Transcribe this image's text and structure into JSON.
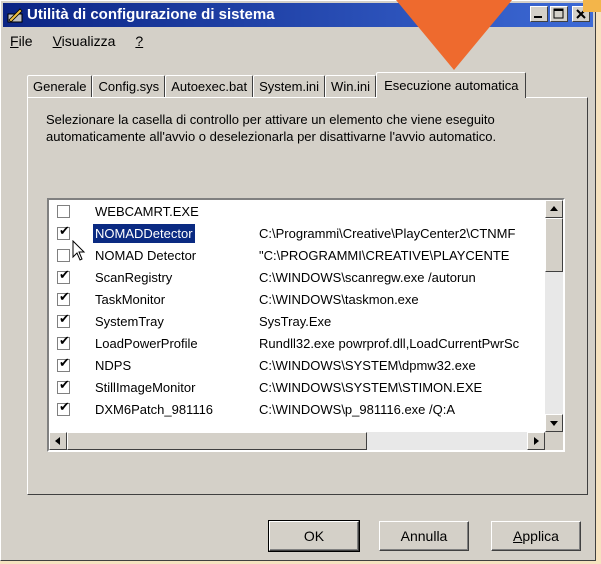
{
  "window": {
    "title": "Utilità di configurazione di sistema"
  },
  "menu": [
    {
      "label": "File",
      "ul": "F",
      "rest": "ile"
    },
    {
      "label": "Visualizza",
      "ul": "V",
      "rest": "isualizza"
    },
    {
      "label": "?",
      "ul": "?",
      "rest": ""
    }
  ],
  "tabs": [
    "Generale",
    "Config.sys",
    "Autoexec.bat",
    "System.ini",
    "Win.ini",
    "Esecuzione automatica"
  ],
  "active_tab": "Esecuzione automatica",
  "description": "Selezionare la casella di controllo per attivare un elemento che viene eseguito automaticamente all'avvio o deselezionarla per disattivarne l'avvio automatico.",
  "startup_items": [
    {
      "checked": false,
      "name": "WEBCAMRT.EXE",
      "command": ""
    },
    {
      "checked": true,
      "name": "NOMADDetector",
      "command": "C:\\Programmi\\Creative\\PlayCenter2\\CTNMF",
      "selected": true
    },
    {
      "checked": false,
      "name": "NOMAD Detector",
      "command": "\"C:\\PROGRAMMI\\CREATIVE\\PLAYCENTE"
    },
    {
      "checked": true,
      "name": "ScanRegistry",
      "command": "C:\\WINDOWS\\scanregw.exe /autorun"
    },
    {
      "checked": true,
      "name": "TaskMonitor",
      "command": "C:\\WINDOWS\\taskmon.exe"
    },
    {
      "checked": true,
      "name": "SystemTray",
      "command": "SysTray.Exe"
    },
    {
      "checked": true,
      "name": "LoadPowerProfile",
      "command": "Rundll32.exe powrprof.dll,LoadCurrentPwrSc"
    },
    {
      "checked": true,
      "name": "NDPS",
      "command": "C:\\WINDOWS\\SYSTEM\\dpmw32.exe"
    },
    {
      "checked": true,
      "name": "StillImageMonitor",
      "command": "C:\\WINDOWS\\SYSTEM\\STIMON.EXE"
    },
    {
      "checked": true,
      "name": "DXM6Patch_981116",
      "command": "C:\\WINDOWS\\p_981116.exe /Q:A"
    }
  ],
  "buttons": {
    "ok": "OK",
    "cancel": "Annulla",
    "apply": "Applica",
    "apply_ul": "A",
    "apply_rest": "pplica"
  },
  "colors": {
    "titlebar_start": "#0b2484",
    "titlebar_end": "#3d6ad6",
    "selection": "#0a2a82",
    "accent_arrow": "#ee6a2e"
  }
}
